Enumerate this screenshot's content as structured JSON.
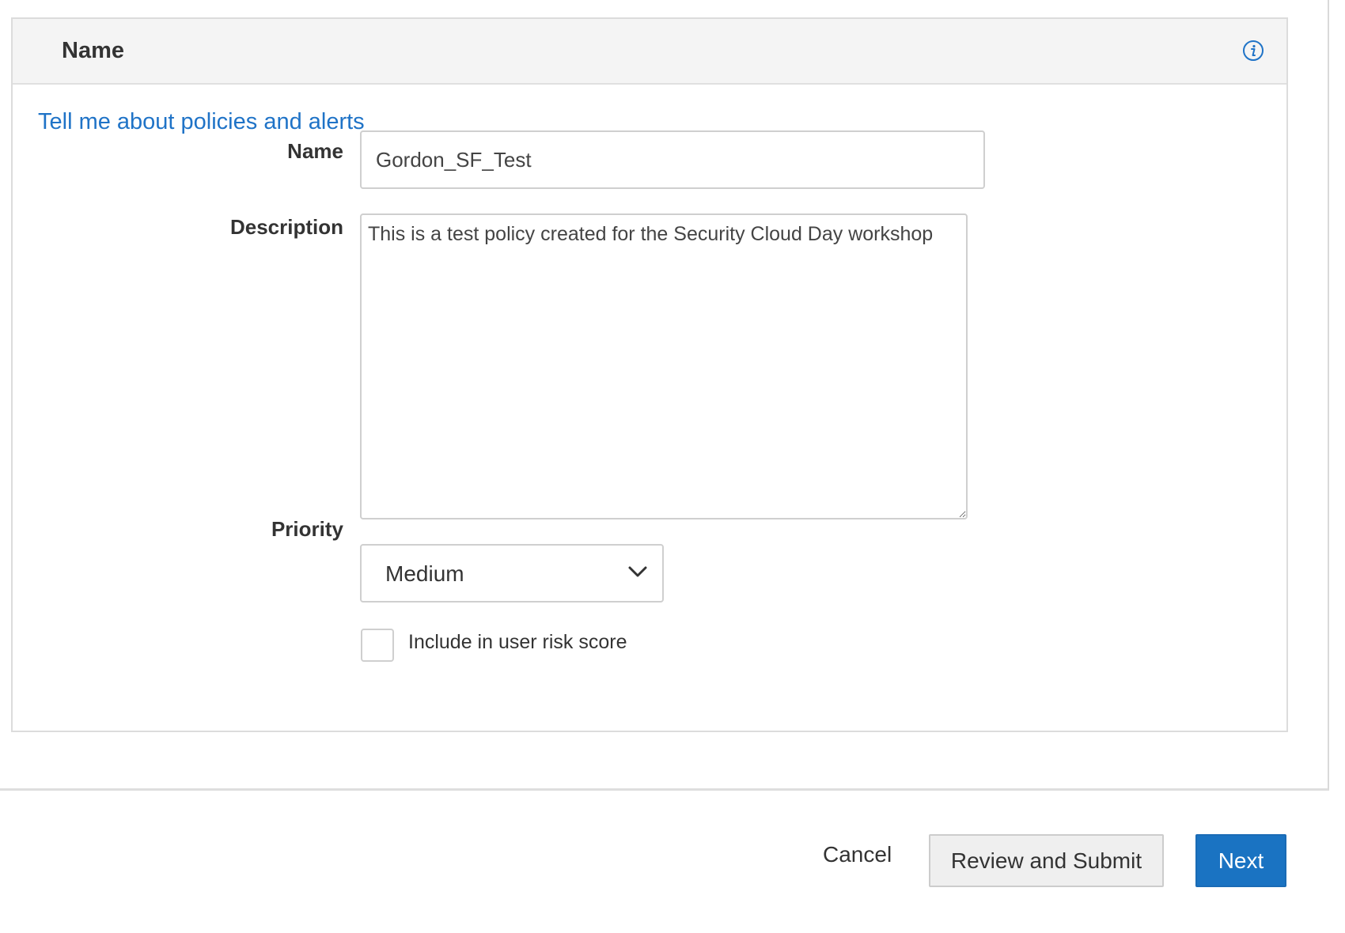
{
  "panel": {
    "title": "Name"
  },
  "help_link": "Tell me about policies and alerts",
  "form": {
    "name_label": "Name",
    "name_value": "Gordon_SF_Test",
    "description_label": "Description",
    "description_value": "This is a test policy created for the Security Cloud Day workshop",
    "priority_label": "Priority",
    "priority_value": "Medium",
    "risk_checkbox_label": "Include in user risk score",
    "risk_checkbox_checked": false
  },
  "footer": {
    "cancel_label": "Cancel",
    "review_label": "Review and Submit",
    "next_label": "Next"
  },
  "colors": {
    "accent": "#1a73c2",
    "link": "#1f73c7",
    "header_bg": "#f4f4f4"
  },
  "icons": {
    "info": "info-icon",
    "dropdown": "chevron-down-icon"
  }
}
